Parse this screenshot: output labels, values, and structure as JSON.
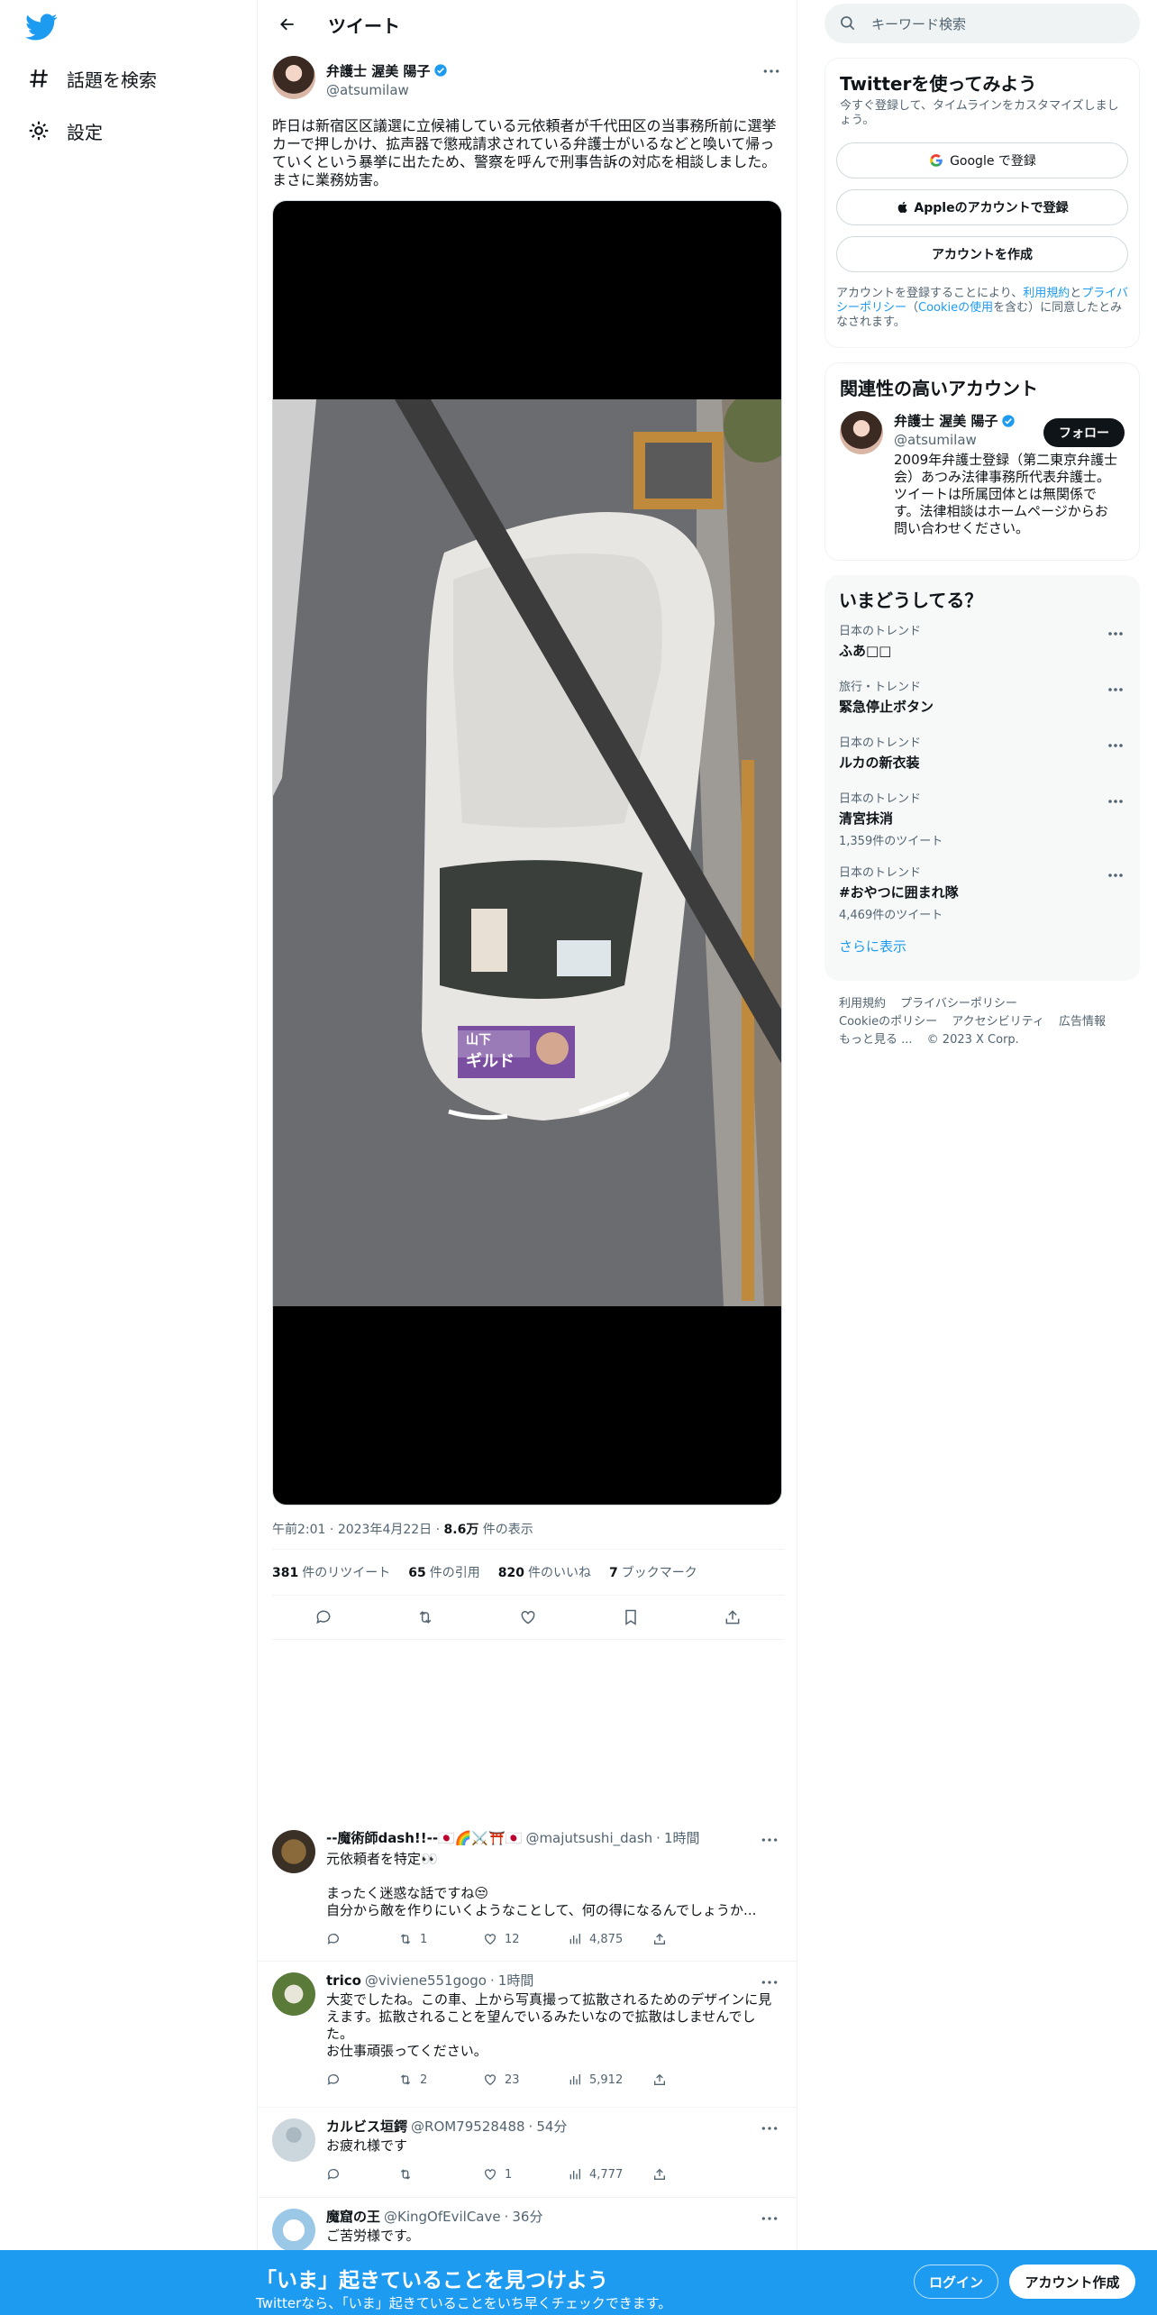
{
  "nav": {
    "explore_label": "話題を検索",
    "settings_label": "設定"
  },
  "header": {
    "title": "ツイート"
  },
  "tweet": {
    "display_name": "弁護士 渥美 陽子",
    "handle": "@atsumilaw",
    "text": "昨日は新宿区区議選に立候補している元依頼者が千代田区の当事務所前に選挙カーで押しかけ、拡声器で懲戒請求されている弁護士がいるなどと喚いて帰っていくという暴挙に出たため、警察を呼んで刑事告訴の対応を相談しました。まさに業務妨害。",
    "time": "午前2:01",
    "date": "2023年4月22日",
    "views_count": "8.6万",
    "views_label": "件の表示",
    "retweets_count": "381",
    "retweets_label": "件のリツイート",
    "quotes_count": "65",
    "quotes_label": "件の引用",
    "likes_count": "820",
    "likes_label": "件のいいね",
    "bookmarks_count": "7",
    "bookmarks_label": "ブックマーク",
    "poster_text_1": "山下",
    "poster_text_2": "ギルド"
  },
  "replies": [
    {
      "name": "--魔術師dash!!--🇯🇵🌈⚔️⛩️🇯🇵",
      "handle": "@majutsushi_dash",
      "time": "1時間",
      "text": "元依頼者を特定👀\n\nまったく迷惑な話ですね😒\n自分から敵を作りにいくようなことして、何の得になるんでしょうか...",
      "retweets": "1",
      "likes": "12",
      "views": "4,875"
    },
    {
      "name": "trico",
      "handle": "@viviene551gogo",
      "time": "1時間",
      "text": "大変でしたね。この車、上から写真撮って拡散されるためのデザインに見えます。拡散されることを望んでいるみたいなので拡散はしませんでした。\nお仕事頑張ってください。",
      "retweets": "2",
      "likes": "23",
      "views": "5,912"
    },
    {
      "name": "カルビス垣鍔",
      "handle": "@ROM79528488",
      "time": "54分",
      "text": "お疲れ様です",
      "retweets": "",
      "likes": "1",
      "views": "4,777"
    },
    {
      "name": "魔窟の王",
      "handle": "@KingOfEvilCave",
      "time": "36分",
      "text": "ご苦労様です。"
    }
  ],
  "search": {
    "placeholder": "キーワード検索"
  },
  "signup": {
    "title": "Twitterを使ってみよう",
    "subtitle": "今すぐ登録して、タイムラインをカスタマイズしましょう。",
    "google_label": "Google で登録",
    "apple_label": "Appleのアカウントで登録",
    "create_label": "アカウントを作成",
    "legal_1": "アカウントを登録することにより、",
    "legal_terms": "利用規約",
    "legal_and": "と",
    "legal_privacy": "プライバシーポリシー",
    "legal_2": "（",
    "legal_cookie": "Cookieの使用",
    "legal_3": "を含む）に同意したとみなされます。"
  },
  "related": {
    "title": "関連性の高いアカウント",
    "display_name": "弁護士 渥美 陽子",
    "handle": "@atsumilaw",
    "follow_label": "フォロー",
    "bio": "2009年弁護士登録（第二東京弁護士会）あつみ法律事務所代表弁護士。ツイートは所属団体とは無関係です。法律相談はホームページからお問い合わせください。"
  },
  "trends": {
    "title": "いまどうしてる？",
    "items": [
      {
        "category": "日本のトレンド",
        "name": "ふあ□□",
        "count": ""
      },
      {
        "category": "旅行・トレンド",
        "name": "緊急停止ボタン",
        "count": ""
      },
      {
        "category": "日本のトレンド",
        "name": "ルカの新衣装",
        "count": ""
      },
      {
        "category": "日本のトレンド",
        "name": "清宮抹消",
        "count": "1,359件のツイート"
      },
      {
        "category": "日本のトレンド",
        "name": "#おやつに囲まれ隊",
        "count": "4,469件のツイート"
      }
    ],
    "show_more": "さらに表示"
  },
  "footer": {
    "terms": "利用規約",
    "privacy": "プライバシーポリシー",
    "cookie": "Cookieのポリシー",
    "accessibility": "アクセシビリティ",
    "ads": "広告情報",
    "more": "もっと見る ...",
    "copyright": "© 2023 X Corp."
  },
  "bottombar": {
    "title": "「いま」起きていることを見つけよう",
    "subtitle": "Twitterなら、「いま」起きていることをいち早くチェックできます。",
    "login_label": "ログイン",
    "create_label": "アカウント作成"
  },
  "colors": {
    "accent": "#1d9bf0",
    "text": "#0f1419",
    "muted": "#536471",
    "border": "#eff3f4"
  }
}
